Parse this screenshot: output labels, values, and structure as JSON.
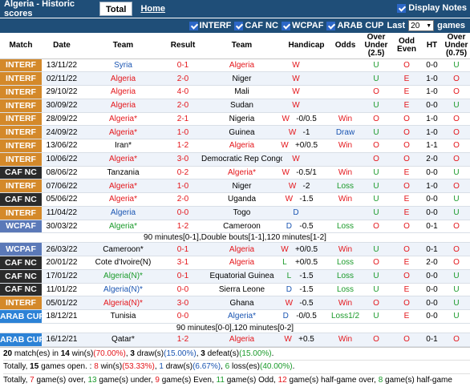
{
  "header": {
    "title": "Algeria - Historic scores",
    "tab_total": "Total",
    "tab_home": "Home",
    "display_notes": "Display Notes"
  },
  "filters": {
    "items": [
      "INTERF",
      "CAF NC",
      "WCPAF",
      "ARAB CUP"
    ],
    "last_label": "Last",
    "count": "20",
    "games_label": "games"
  },
  "columns": {
    "match": "Match",
    "date": "Date",
    "team_home": "Team",
    "result": "Result",
    "team_away": "Team",
    "handicap": "Handicap",
    "odds": "Odds",
    "over_under": "Over Under (2.5)",
    "odd_even": "Odd Even",
    "ht": "HT",
    "over_under_ht": "Over Under (0.75)"
  },
  "colors": {
    "INTERF": "#d4892a",
    "CAF NC": "#2b2b2b",
    "WCPAF": "#5b79b8",
    "ARAB CUP": "#2c82d6"
  },
  "rows": [
    {
      "comp": "INTERF",
      "date": "13/11/22",
      "home": "Syria",
      "home_c": "blue",
      "score": "0-1",
      "away": "Algeria",
      "away_c": "red",
      "wl": "W",
      "wl_c": "red",
      "hcp": "",
      "odds": "",
      "odds_c": "",
      "ou": "U",
      "ou_c": "green",
      "oe": "O",
      "oe_c": "red",
      "ht": "0-0",
      "ht_ou": "U",
      "ht_ou_c": "green"
    },
    {
      "comp": "INTERF",
      "date": "02/11/22",
      "home": "Algeria",
      "home_c": "red",
      "score": "2-0",
      "away": "Niger",
      "away_c": "",
      "wl": "W",
      "wl_c": "red",
      "hcp": "",
      "odds": "",
      "odds_c": "",
      "ou": "U",
      "ou_c": "green",
      "oe": "E",
      "oe_c": "red",
      "ht": "1-0",
      "ht_ou": "O",
      "ht_ou_c": "red"
    },
    {
      "comp": "INTERF",
      "date": "29/10/22",
      "home": "Algeria",
      "home_c": "red",
      "score": "4-0",
      "away": "Mali",
      "away_c": "",
      "wl": "W",
      "wl_c": "red",
      "hcp": "",
      "odds": "",
      "odds_c": "",
      "ou": "O",
      "ou_c": "red",
      "oe": "E",
      "oe_c": "red",
      "ht": "1-0",
      "ht_ou": "O",
      "ht_ou_c": "red"
    },
    {
      "comp": "INTERF",
      "date": "30/09/22",
      "home": "Algeria",
      "home_c": "red",
      "score": "2-0",
      "away": "Sudan",
      "away_c": "",
      "wl": "W",
      "wl_c": "red",
      "hcp": "",
      "odds": "",
      "odds_c": "",
      "ou": "U",
      "ou_c": "green",
      "oe": "E",
      "oe_c": "red",
      "ht": "0-0",
      "ht_ou": "U",
      "ht_ou_c": "green"
    },
    {
      "comp": "INTERF",
      "date": "28/09/22",
      "home": "Algeria*",
      "home_c": "red",
      "score": "2-1",
      "away": "Nigeria",
      "away_c": "",
      "wl": "W",
      "wl_c": "red",
      "hcp": "-0/0.5",
      "odds": "Win",
      "odds_c": "red",
      "ou": "O",
      "ou_c": "red",
      "oe": "O",
      "oe_c": "red",
      "ht": "1-0",
      "ht_ou": "O",
      "ht_ou_c": "red"
    },
    {
      "comp": "INTERF",
      "date": "24/09/22",
      "home": "Algeria*",
      "home_c": "red",
      "score": "1-0",
      "away": "Guinea",
      "away_c": "",
      "wl": "W",
      "wl_c": "red",
      "hcp": "-1",
      "odds": "Draw",
      "odds_c": "blue",
      "ou": "U",
      "ou_c": "green",
      "oe": "O",
      "oe_c": "red",
      "ht": "1-0",
      "ht_ou": "O",
      "ht_ou_c": "red"
    },
    {
      "comp": "INTERF",
      "date": "13/06/22",
      "home": "Iran*",
      "home_c": "",
      "score": "1-2",
      "away": "Algeria",
      "away_c": "red",
      "wl": "W",
      "wl_c": "red",
      "hcp": "+0/0.5",
      "odds": "Win",
      "odds_c": "red",
      "ou": "O",
      "ou_c": "red",
      "oe": "O",
      "oe_c": "red",
      "ht": "1-1",
      "ht_ou": "O",
      "ht_ou_c": "red"
    },
    {
      "comp": "INTERF",
      "date": "10/06/22",
      "home": "Algeria*",
      "home_c": "red",
      "score": "3-0",
      "away": "Democratic Rep Congo",
      "away_c": "",
      "wl": "W",
      "wl_c": "red",
      "hcp": "",
      "odds": "",
      "odds_c": "",
      "ou": "O",
      "ou_c": "red",
      "oe": "O",
      "oe_c": "red",
      "ht": "2-0",
      "ht_ou": "O",
      "ht_ou_c": "red"
    },
    {
      "comp": "CAF NC",
      "date": "08/06/22",
      "home": "Tanzania",
      "home_c": "",
      "score": "0-2",
      "away": "Algeria*",
      "away_c": "red",
      "wl": "W",
      "wl_c": "red",
      "hcp": "-0.5/1",
      "odds": "Win",
      "odds_c": "red",
      "ou": "U",
      "ou_c": "green",
      "oe": "E",
      "oe_c": "red",
      "ht": "0-0",
      "ht_ou": "U",
      "ht_ou_c": "green"
    },
    {
      "comp": "INTERF",
      "date": "07/06/22",
      "home": "Algeria*",
      "home_c": "red",
      "score": "1-0",
      "away": "Niger",
      "away_c": "",
      "wl": "W",
      "wl_c": "red",
      "hcp": "-2",
      "odds": "Loss",
      "odds_c": "green",
      "ou": "U",
      "ou_c": "green",
      "oe": "O",
      "oe_c": "red",
      "ht": "1-0",
      "ht_ou": "O",
      "ht_ou_c": "red"
    },
    {
      "comp": "CAF NC",
      "date": "05/06/22",
      "home": "Algeria*",
      "home_c": "red",
      "score": "2-0",
      "away": "Uganda",
      "away_c": "",
      "wl": "W",
      "wl_c": "red",
      "hcp": "-1.5",
      "odds": "Win",
      "odds_c": "red",
      "ou": "U",
      "ou_c": "green",
      "oe": "E",
      "oe_c": "red",
      "ht": "0-0",
      "ht_ou": "U",
      "ht_ou_c": "green"
    },
    {
      "comp": "INTERF",
      "date": "11/04/22",
      "home": "Algeria",
      "home_c": "blue",
      "score": "0-0",
      "away": "Togo",
      "away_c": "",
      "wl": "D",
      "wl_c": "blue",
      "hcp": "",
      "odds": "",
      "odds_c": "",
      "ou": "U",
      "ou_c": "green",
      "oe": "E",
      "oe_c": "red",
      "ht": "0-0",
      "ht_ou": "U",
      "ht_ou_c": "green"
    },
    {
      "comp": "WCPAF",
      "date": "30/03/22",
      "home": "Algeria*",
      "home_c": "green",
      "score": "1-2",
      "away": "Cameroon",
      "away_c": "",
      "wl": "D",
      "wl_c": "blue",
      "hcp": "-0.5",
      "odds": "Loss",
      "odds_c": "green",
      "ou": "O",
      "ou_c": "red",
      "oe": "O",
      "oe_c": "red",
      "ht": "0-1",
      "ht_ou": "O",
      "ht_ou_c": "red",
      "note": "90 minutes[0-1],Double bouts[1-1],120 minutes[1-2]"
    },
    {
      "comp": "WCPAF",
      "date": "26/03/22",
      "home": "Cameroon*",
      "home_c": "",
      "score": "0-1",
      "away": "Algeria",
      "away_c": "red",
      "wl": "W",
      "wl_c": "red",
      "hcp": "+0/0.5",
      "odds": "Win",
      "odds_c": "red",
      "ou": "U",
      "ou_c": "green",
      "oe": "O",
      "oe_c": "red",
      "ht": "0-1",
      "ht_ou": "O",
      "ht_ou_c": "red"
    },
    {
      "comp": "CAF NC",
      "date": "20/01/22",
      "home": "Cote d'Ivoire(N)",
      "home_c": "",
      "score": "3-1",
      "away": "Algeria",
      "away_c": "red",
      "wl": "L",
      "wl_c": "green",
      "hcp": "+0/0.5",
      "odds": "Loss",
      "odds_c": "green",
      "ou": "O",
      "ou_c": "red",
      "oe": "E",
      "oe_c": "red",
      "ht": "2-0",
      "ht_ou": "O",
      "ht_ou_c": "red"
    },
    {
      "comp": "CAF NC",
      "date": "17/01/22",
      "home": "Algeria(N)*",
      "home_c": "green",
      "score": "0-1",
      "away": "Equatorial Guinea",
      "away_c": "",
      "wl": "L",
      "wl_c": "green",
      "hcp": "-1.5",
      "odds": "Loss",
      "odds_c": "green",
      "ou": "U",
      "ou_c": "green",
      "oe": "O",
      "oe_c": "red",
      "ht": "0-0",
      "ht_ou": "U",
      "ht_ou_c": "green"
    },
    {
      "comp": "CAF NC",
      "date": "11/01/22",
      "home": "Algeria(N)*",
      "home_c": "blue",
      "score": "0-0",
      "away": "Sierra Leone",
      "away_c": "",
      "wl": "D",
      "wl_c": "blue",
      "hcp": "-1.5",
      "odds": "Loss",
      "odds_c": "green",
      "ou": "U",
      "ou_c": "green",
      "oe": "E",
      "oe_c": "red",
      "ht": "0-0",
      "ht_ou": "U",
      "ht_ou_c": "green"
    },
    {
      "comp": "INTERF",
      "date": "05/01/22",
      "home": "Algeria(N)*",
      "home_c": "red",
      "score": "3-0",
      "away": "Ghana",
      "away_c": "",
      "wl": "W",
      "wl_c": "red",
      "hcp": "-0.5",
      "odds": "Win",
      "odds_c": "red",
      "ou": "O",
      "ou_c": "red",
      "oe": "O",
      "oe_c": "red",
      "ht": "0-0",
      "ht_ou": "U",
      "ht_ou_c": "green"
    },
    {
      "comp": "ARAB CUP",
      "date": "18/12/21",
      "home": "Tunisia",
      "home_c": "",
      "score": "0-0",
      "away": "Algeria*",
      "away_c": "blue",
      "wl": "D",
      "wl_c": "blue",
      "hcp": "-0/0.5",
      "odds": "Loss1/2",
      "odds_c": "green",
      "ou": "U",
      "ou_c": "green",
      "oe": "E",
      "oe_c": "red",
      "ht": "0-0",
      "ht_ou": "U",
      "ht_ou_c": "green",
      "note": "90 minutes[0-0],120 minutes[0-2]"
    },
    {
      "comp": "ARAB CUP",
      "date": "16/12/21",
      "home": "Qatar*",
      "home_c": "",
      "score": "1-2",
      "away": "Algeria",
      "away_c": "red",
      "wl": "W",
      "wl_c": "red",
      "hcp": "+0.5",
      "odds": "Win",
      "odds_c": "red",
      "ou": "O",
      "ou_c": "red",
      "oe": "O",
      "oe_c": "red",
      "ht": "0-1",
      "ht_ou": "O",
      "ht_ou_c": "red"
    }
  ],
  "summary": {
    "line1": [
      {
        "t": "20",
        "s": "b"
      },
      {
        "t": " match(es) in "
      },
      {
        "t": "14",
        "s": "b"
      },
      {
        "t": " win(s)"
      },
      {
        "t": "(70.00%)",
        "s": "red"
      },
      {
        "t": ", "
      },
      {
        "t": "3",
        "s": "b"
      },
      {
        "t": " draw(s)"
      },
      {
        "t": "(15.00%)",
        "s": "blue"
      },
      {
        "t": ", "
      },
      {
        "t": "3",
        "s": "b"
      },
      {
        "t": " defeat(s)"
      },
      {
        "t": "(15.00%)",
        "s": "green"
      },
      {
        "t": "."
      }
    ],
    "line2": [
      {
        "t": "Totally, "
      },
      {
        "t": "15",
        "s": "b"
      },
      {
        "t": " games open. : "
      },
      {
        "t": "8",
        "s": "red"
      },
      {
        "t": " win(s)"
      },
      {
        "t": "(53.33%)",
        "s": "red"
      },
      {
        "t": ", "
      },
      {
        "t": "1",
        "s": "blue"
      },
      {
        "t": " draw(s)"
      },
      {
        "t": "(6.67%)",
        "s": "blue"
      },
      {
        "t": ", "
      },
      {
        "t": "6",
        "s": "green"
      },
      {
        "t": " loss(es)"
      },
      {
        "t": "(40.00%)",
        "s": "green"
      },
      {
        "t": "."
      }
    ],
    "line3": [
      {
        "t": "Totally, "
      },
      {
        "t": "7",
        "s": "red"
      },
      {
        "t": " game(s) over, "
      },
      {
        "t": "13",
        "s": "green"
      },
      {
        "t": " game(s) under, "
      },
      {
        "t": "9",
        "s": "red"
      },
      {
        "t": " game(s) Even, "
      },
      {
        "t": "11",
        "s": "green"
      },
      {
        "t": " game(s) Odd, "
      },
      {
        "t": "12",
        "s": "red"
      },
      {
        "t": " game(s) half-game over, "
      },
      {
        "t": "8",
        "s": "green"
      },
      {
        "t": " game(s) half-game under"
      }
    ]
  }
}
